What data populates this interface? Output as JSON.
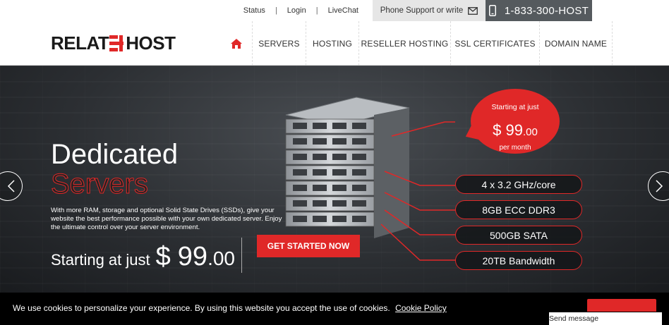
{
  "topbar": {
    "links": [
      "Status",
      "Login",
      "LiveChat"
    ],
    "separator": "|",
    "phone_support": "Phone Support or write",
    "phone_number": "1-833-300-HOST"
  },
  "logo": {
    "part1": "RELAT",
    "part2": "HOST"
  },
  "nav": {
    "items": [
      "SERVERS",
      "HOSTING",
      "RESELLER HOSTING",
      "SSL CERTIFICATES",
      "DOMAIN NAME"
    ]
  },
  "hero": {
    "title_line1": "Dedicated",
    "title_line2": "Servers",
    "description": "With more RAM, storage and optional Solid State Drives (SSDs), give your website the best performance possible with your own dedicated server. Enjoy the ultimate control over your server environment.",
    "starting_label": "Starting at just",
    "currency": "$",
    "price_whole": "99",
    "price_cents": ".00",
    "cta_label": "GET STARTED NOW",
    "badge": {
      "line1": "Starting at just",
      "price_whole": "$ 99",
      "price_cents": ".00",
      "period": "per month"
    },
    "specs": [
      "4 x 3.2 GHz/core",
      "8GB ECC DDR3",
      "500GB SATA",
      "20TB Bandwidth"
    ]
  },
  "cookie": {
    "text": "We use cookies to personalize your experience. By using this website you accept the use of cookies.",
    "link": "Cookie Policy",
    "send_message": "Send message"
  },
  "colors": {
    "accent": "#e02828",
    "dark_bar": "#555a5e"
  }
}
